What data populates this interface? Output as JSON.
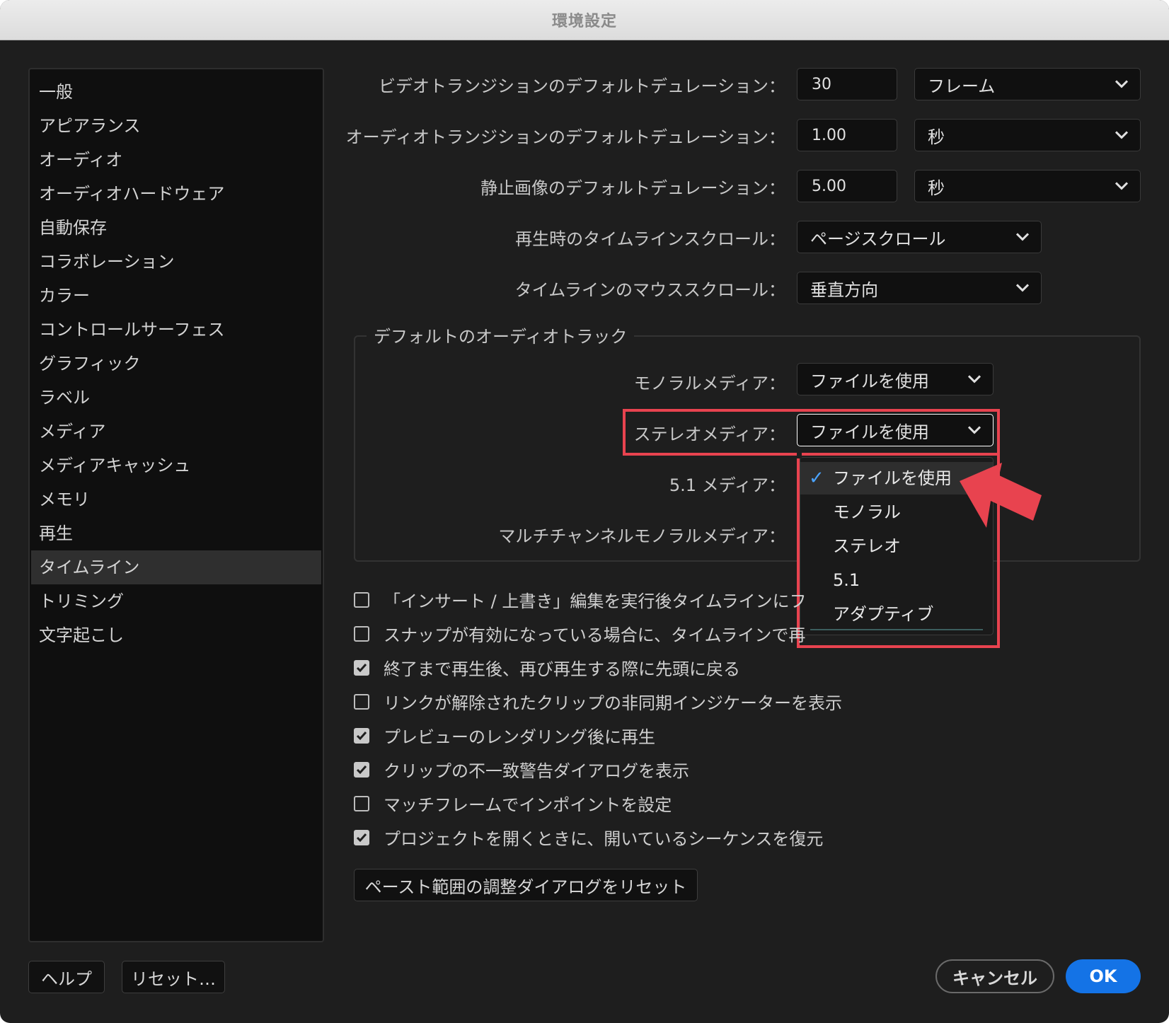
{
  "window": {
    "title": "環境設定"
  },
  "sidebar": {
    "items": [
      {
        "label": "一般"
      },
      {
        "label": "アピアランス"
      },
      {
        "label": "オーディオ"
      },
      {
        "label": "オーディオハードウェア"
      },
      {
        "label": "自動保存"
      },
      {
        "label": "コラボレーション"
      },
      {
        "label": "カラー"
      },
      {
        "label": "コントロールサーフェス"
      },
      {
        "label": "グラフィック"
      },
      {
        "label": "ラベル"
      },
      {
        "label": "メディア"
      },
      {
        "label": "メディアキャッシュ"
      },
      {
        "label": "メモリ"
      },
      {
        "label": "再生"
      },
      {
        "label": "タイムライン"
      },
      {
        "label": "トリミング"
      },
      {
        "label": "文字起こし"
      }
    ],
    "selected": "タイムライン"
  },
  "settings": {
    "video_transition": {
      "label": "ビデオトランジションのデフォルトデュレーション：",
      "value": "30",
      "unit": "フレーム"
    },
    "audio_transition": {
      "label": "オーディオトランジションのデフォルトデュレーション：",
      "value": "1.00",
      "unit": "秒"
    },
    "still_image": {
      "label": "静止画像のデフォルトデュレーション：",
      "value": "5.00",
      "unit": "秒"
    },
    "playback_scroll": {
      "label": "再生時のタイムラインスクロール：",
      "value": "ページスクロール"
    },
    "mouse_scroll": {
      "label": "タイムラインのマウススクロール：",
      "value": "垂直方向"
    }
  },
  "audio_tracks": {
    "title": "デフォルトのオーディオトラック",
    "mono": {
      "label": "モノラルメディア：",
      "value": "ファイルを使用"
    },
    "stereo": {
      "label": "ステレオメディア：",
      "value": "ファイルを使用"
    },
    "five_one": {
      "label": "5.1 メディア："
    },
    "multichannel": {
      "label": "マルチチャンネルモノラルメディア："
    }
  },
  "dropdown": {
    "options": [
      "ファイルを使用",
      "モノラル",
      "ステレオ",
      "5.1",
      "アダプティブ"
    ],
    "selected": "ファイルを使用",
    "check_glyph": "✓"
  },
  "checkboxes": [
    {
      "label": "「インサート / 上書き」編集を実行後タイムラインにフ",
      "checked": false
    },
    {
      "label": "スナップが有効になっている場合に、タイムラインで再",
      "checked": false
    },
    {
      "label": "終了まで再生後、再び再生する際に先頭に戻る",
      "checked": true
    },
    {
      "label": "リンクが解除されたクリップの非同期インジケーターを表示",
      "checked": false
    },
    {
      "label": "プレビューのレンダリング後に再生",
      "checked": true
    },
    {
      "label": "クリップの不一致警告ダイアログを表示",
      "checked": true
    },
    {
      "label": "マッチフレームでインポイントを設定",
      "checked": false
    },
    {
      "label": "プロジェクトを開くときに、開いているシーケンスを復元",
      "checked": true
    }
  ],
  "buttons": {
    "reset_paste": "ペースト範囲の調整ダイアログをリセット",
    "help": "ヘルプ",
    "reset": "リセット…",
    "cancel": "キャンセル",
    "ok": "OK"
  },
  "colors": {
    "highlight": "#e8434f",
    "accent": "#1473e6",
    "check": "#4aa3ff"
  },
  "icons": {
    "chevron": "chevron-down-icon",
    "checkmark": "checkmark-icon",
    "arrow": "arrow-pointer-icon"
  }
}
